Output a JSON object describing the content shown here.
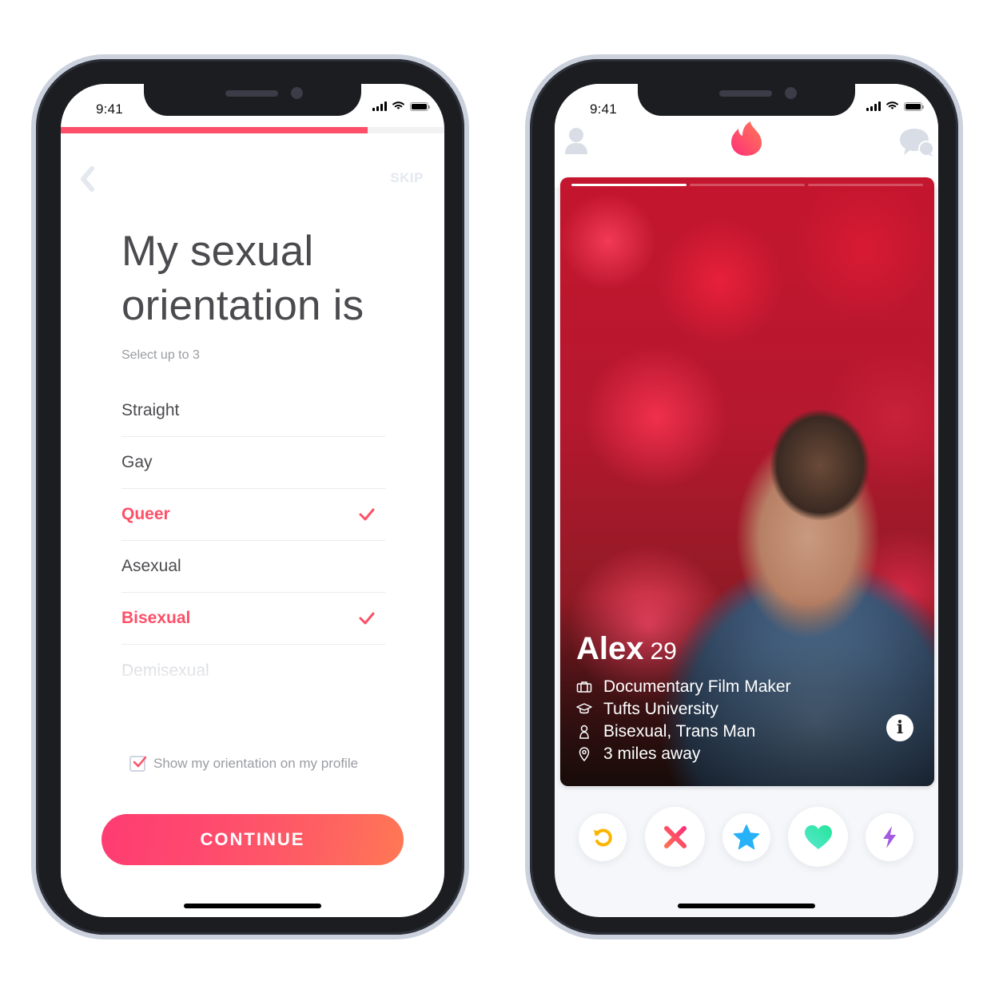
{
  "status_bar": {
    "time": "9:41"
  },
  "left_phone": {
    "progress_fraction": 0.8,
    "back_label": "Back",
    "skip_label": "SKIP",
    "title": "My sexual orientation is",
    "subtitle": "Select up to 3",
    "options": [
      {
        "label": "Straight",
        "selected": false
      },
      {
        "label": "Gay",
        "selected": false
      },
      {
        "label": "Queer",
        "selected": true
      },
      {
        "label": "Asexual",
        "selected": false
      },
      {
        "label": "Bisexual",
        "selected": true
      },
      {
        "label": "Demisexual",
        "selected": false
      }
    ],
    "show_on_profile": {
      "label": "Show my orientation on my profile",
      "checked": true
    },
    "continue_label": "CONTINUE"
  },
  "right_phone": {
    "header_icons": [
      "profile-icon",
      "tinder-flame-icon",
      "chat-icon"
    ],
    "photo_count": 3,
    "active_photo": 1,
    "profile": {
      "name": "Alex",
      "age": "29",
      "details": [
        {
          "icon": "briefcase-icon",
          "text": "Documentary Film Maker"
        },
        {
          "icon": "graduation-cap-icon",
          "text": "Tufts University"
        },
        {
          "icon": "person-icon",
          "text": "Bisexual, Trans Man"
        },
        {
          "icon": "location-pin-icon",
          "text": "3 miles away"
        }
      ],
      "info_label": "i"
    },
    "actions": [
      {
        "name": "rewind",
        "icon": "rewind-icon",
        "color": "#fbb500"
      },
      {
        "name": "nope",
        "icon": "x-icon",
        "color": "#fd4e6b"
      },
      {
        "name": "super-like",
        "icon": "star-icon",
        "color": "#26b1f8"
      },
      {
        "name": "like",
        "icon": "heart-icon",
        "color": "#2ee3a7"
      },
      {
        "name": "boost",
        "icon": "lightning-icon",
        "color": "#a45ae0"
      }
    ]
  },
  "colors": {
    "brand": "#fd5068",
    "text": "#4b4b4f",
    "muted": "#9a9ca2"
  }
}
